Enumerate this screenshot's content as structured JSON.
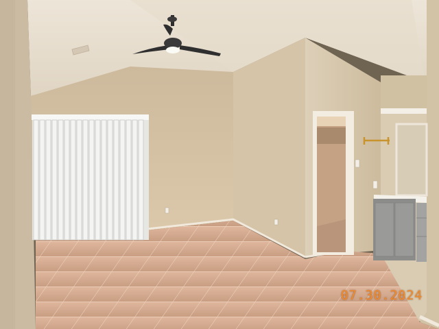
{
  "photo": {
    "subject": "empty-room-with-vaulted-ceiling",
    "date_stamp": "07.30.2024",
    "colors": {
      "ceiling": "#e9e0d2",
      "wall_back": "#d7c4a7",
      "wall_right": "#d8cab2",
      "tile_floor": "#d3a88c",
      "blind": "#f1f1ef",
      "stamp": "#f08a2a"
    }
  }
}
